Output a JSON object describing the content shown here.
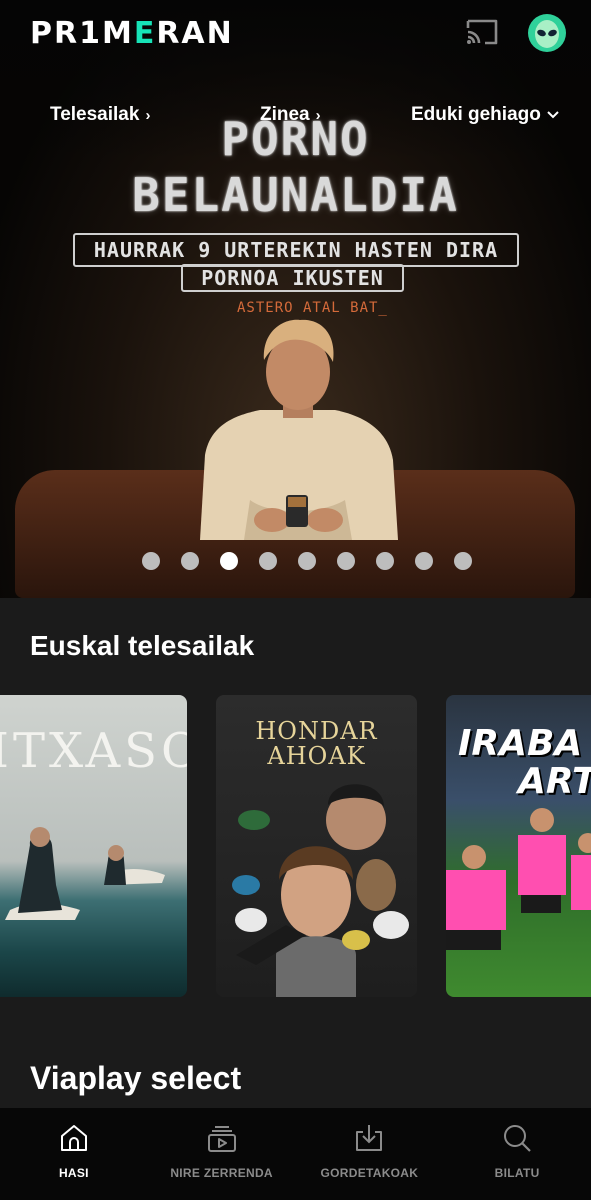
{
  "header": {
    "logo_pre": "PR1M",
    "logo_accent": "E",
    "logo_post": "RAN",
    "accent_color": "#17e3b7"
  },
  "nav": [
    {
      "label": "Telesailak",
      "icon": "chevron-right-icon"
    },
    {
      "label": "Zinea",
      "icon": "chevron-right-icon"
    },
    {
      "label": "Eduki gehiago",
      "icon": "chevron-down-icon"
    }
  ],
  "hero": {
    "title_line1": "PORNO",
    "title_line2": "BELAUNALDIA",
    "tagline_line1": "HAURRAK 9 URTEREKIN HASTEN DIRA",
    "tagline_line2": "PORNOA IKUSTEN",
    "subtitle": "ASTERO ATAL BAT_",
    "carousel_count": 9,
    "carousel_active": 3
  },
  "sections": [
    {
      "title": "Euskal telesailak",
      "cards": [
        {
          "title": "ITXASO"
        },
        {
          "title": "HONDAR AHOAK",
          "title_line1": "HONDAR",
          "title_line2": "AHOAK"
        },
        {
          "title_line1": "IRABA",
          "title_line2": "ART"
        }
      ]
    },
    {
      "title": "Viaplay select"
    }
  ],
  "bottom_nav": [
    {
      "label": "HASI",
      "icon": "home-icon",
      "active": true
    },
    {
      "label": "NIRE ZERRENDA",
      "icon": "play-list-icon",
      "active": false
    },
    {
      "label": "GORDETAKOAK",
      "icon": "download-icon",
      "active": false
    },
    {
      "label": "BILATU",
      "icon": "search-icon",
      "active": false
    }
  ]
}
